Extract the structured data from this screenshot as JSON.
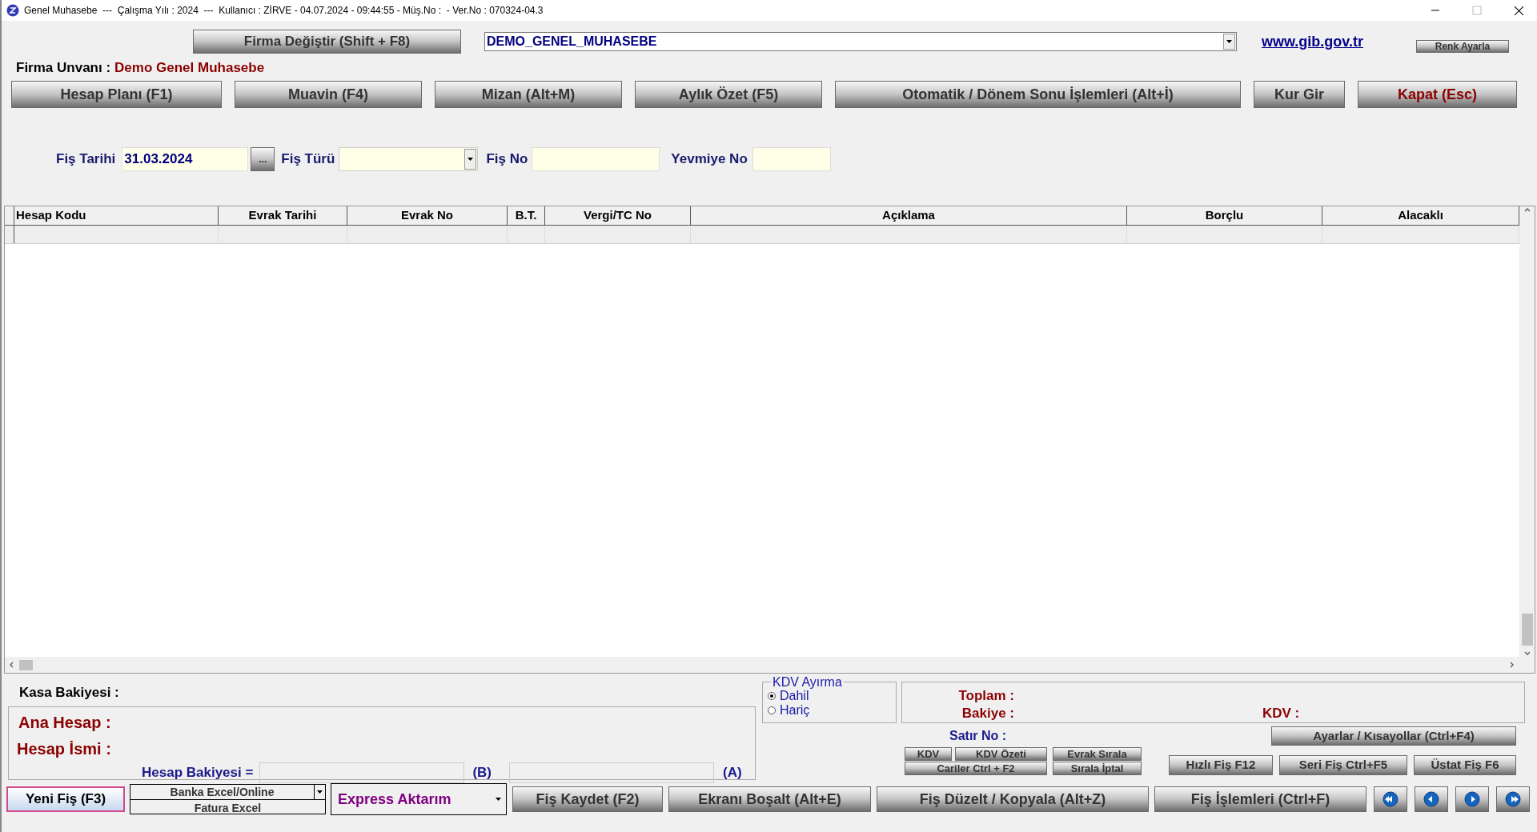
{
  "window": {
    "title": "Genel Muhasebe  ---  Çalışma Yılı : 2024  ---  Kullanıcı : ZİRVE - 04.07.2024 - 09:44:55 - Müş.No :  - Ver.No : 070324-04.3"
  },
  "header": {
    "firm_button": "Firma Değiştir (Shift + F8)",
    "company_combo": "DEMO_GENEL_MUHASEBE",
    "link": "www.gib.gov.tr",
    "color_button": "Renk Ayarla",
    "firm_label": "Firma Unvanı :",
    "firm_name": "Demo Genel Muhasebe"
  },
  "menu_buttons": [
    {
      "label": "Hesap Planı (F1)",
      "kind": "normal"
    },
    {
      "label": "Muavin (F4)",
      "kind": "normal"
    },
    {
      "label": "Mizan (Alt+M)",
      "kind": "normal"
    },
    {
      "label": "Aylık Özet (F5)",
      "kind": "normal"
    },
    {
      "label": "Otomatik / Dönem Sonu İşlemleri (Alt+İ)",
      "kind": "normal"
    },
    {
      "label": "Kur Gir",
      "kind": "normal"
    },
    {
      "label": "Kapat (Esc)",
      "kind": "danger"
    }
  ],
  "voucher": {
    "date_label": "Fiş Tarihi",
    "date_value": "31.03.2024",
    "date_button": "...",
    "type_label": "Fiş Türü",
    "number_label": "Fiş No",
    "journal_label": "Yevmiye No"
  },
  "table": {
    "columns": [
      "Hesap Kodu",
      "Evrak Tarihi",
      "Evrak No",
      "B.T.",
      "Vergi/TC No",
      "Açıklama",
      "Borçlu",
      "Alacaklı"
    ],
    "empty_row": true
  },
  "account": {
    "cash_label": "Kasa Bakiyesi :",
    "main_label": "Ana Hesap :",
    "name_label": "Hesap İsmi :",
    "balance_label": "Hesap Bakiyesi =",
    "b_label": "(B)",
    "a_label": "(A)"
  },
  "kdv": {
    "title": "KDV Ayırma",
    "options": [
      {
        "label": "Dahil",
        "selected": true
      },
      {
        "label": "Hariç",
        "selected": false
      }
    ]
  },
  "totals": {
    "total_label": "Toplam :",
    "balance_label": "Bakiye :",
    "kdv_label": "KDV :",
    "row_label": "Satır No :"
  },
  "small_buttons": [
    {
      "label": "KDV"
    },
    {
      "label": "KDV Özeti"
    },
    {
      "label": "Evrak Sırala"
    },
    {
      "label": "Cariler Ctrl + F2"
    },
    {
      "label": "Sırala İptal"
    }
  ],
  "settings_button": "Ayarlar / Kısayollar (Ctrl+F4)",
  "quick_buttons": [
    "Hızlı Fiş F12",
    "Seri Fiş Ctrl+F5",
    "Üstat Fiş F6"
  ],
  "bottom": {
    "new_button": {
      "label": "Yeni Fiş (F3)",
      "focused": true
    },
    "bank_excel": "Banka Excel/Online",
    "invoice_excel": "Fatura Excel",
    "express": "Express Aktarım",
    "actions": [
      "Fiş Kaydet (F2)",
      "Ekranı Boşalt (Alt+E)",
      "Fiş Düzelt / Kopyala (Alt+Z)",
      "Fiş İşlemleri (Ctrl+F)"
    ]
  }
}
